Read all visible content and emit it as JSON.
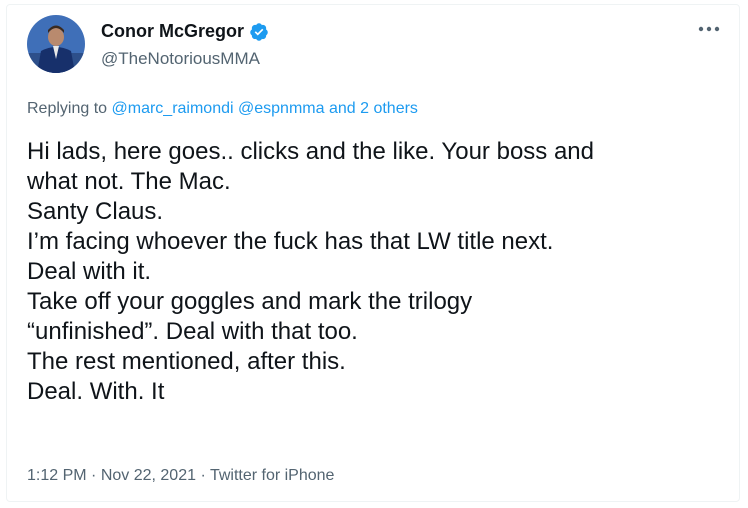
{
  "author": {
    "display_name": "Conor McGregor",
    "handle": "@TheNotoriousMMA",
    "verified": true,
    "verified_icon": "verified-badge-icon",
    "verified_color": "#1d9bf0"
  },
  "more_icon": "more-horizontal-icon",
  "replying": {
    "prefix": "Replying to ",
    "mention_1": "@marc_raimondi",
    "mention_2": "@espnmma",
    "connector": " and ",
    "others": "2 others"
  },
  "tweet": {
    "lines": [
      "Hi lads, here goes.. clicks and the like. Your boss and",
      "what not. The Mac.",
      "Santy Claus.",
      "I’m facing whoever the fuck has that LW title next.",
      "Deal with it.",
      "Take off your goggles and mark the trilogy",
      "“unfinished”. Deal with that too.",
      "The rest mentioned, after this.",
      "Deal. With. It"
    ]
  },
  "meta": {
    "time": "1:12 PM",
    "separator_1": " · ",
    "date": "Nov 22, 2021",
    "separator_2": " · ",
    "source": "Twitter for iPhone"
  },
  "colors": {
    "text": "#0f1419",
    "secondary": "#536471",
    "accent": "#1d9bf0"
  }
}
